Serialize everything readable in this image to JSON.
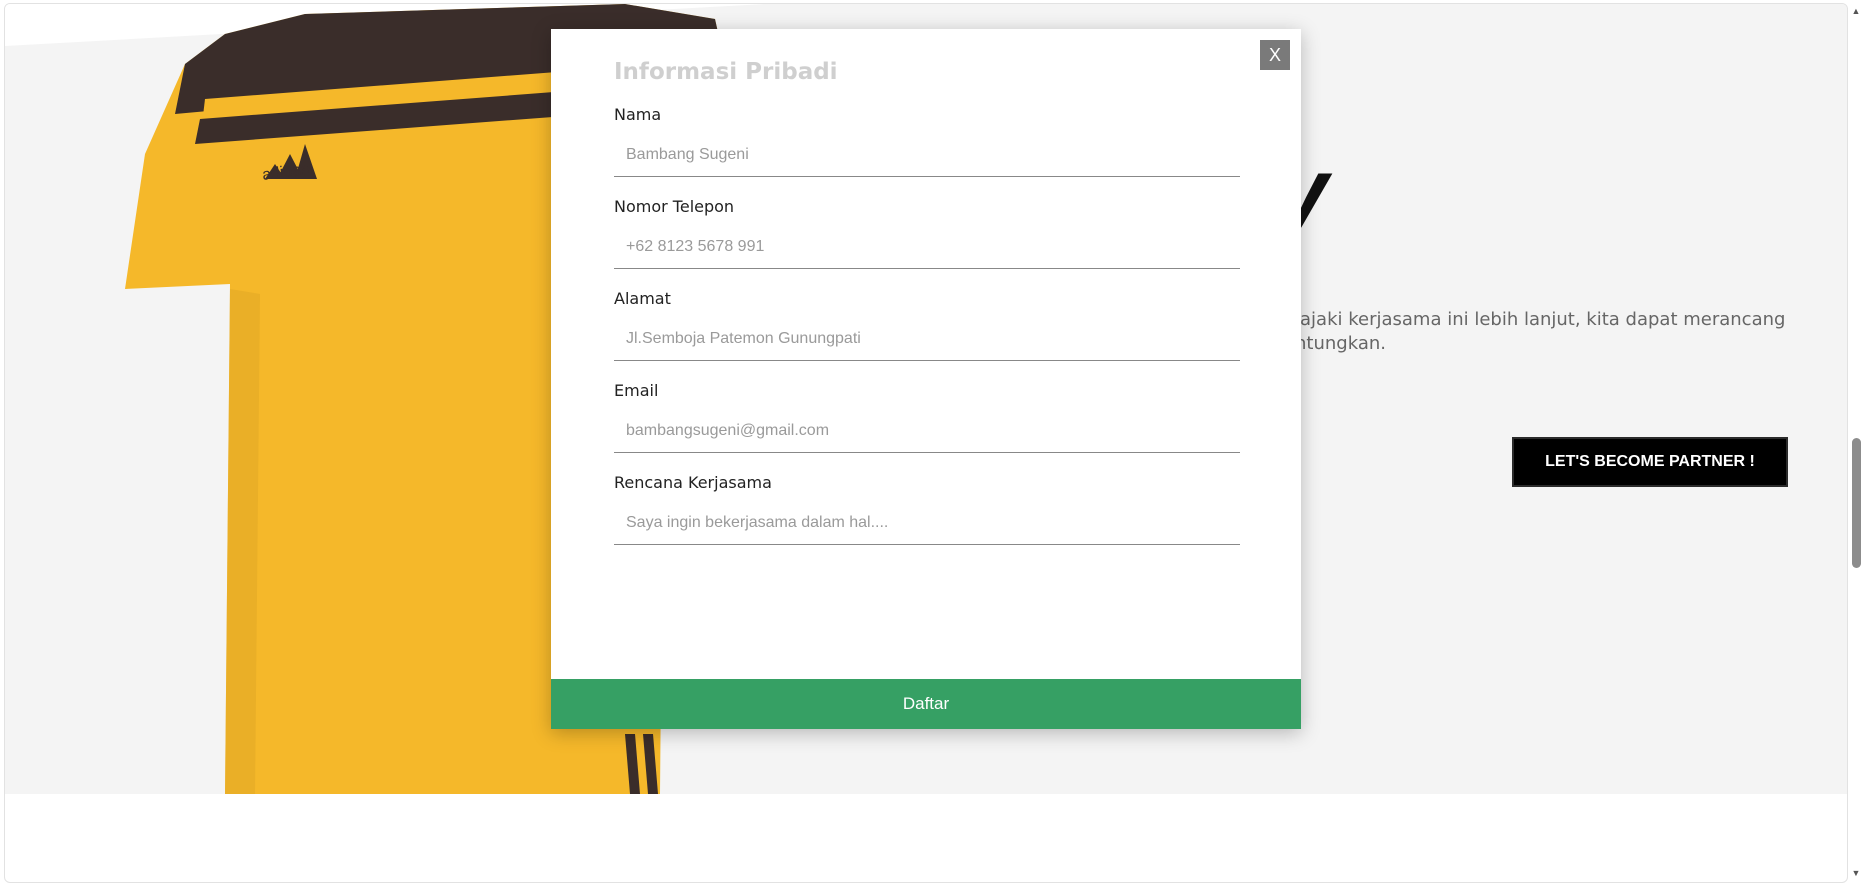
{
  "hero": {
    "heading_fragment": "y",
    "description_line1": "jajaki kerjasama ini lebih lanjut, kita dapat merancang",
    "description_line2": "ntungkan.",
    "partner_button": "LET'S BECOME PARTNER !",
    "shirt_brand": "adidas",
    "colors": {
      "shirt": "#f5b82a",
      "stripe": "#3a2d2a",
      "background": "#f4f4f4"
    }
  },
  "modal": {
    "close_label": "X",
    "title": "Informasi Pribadi",
    "fields": [
      {
        "label": "Nama",
        "placeholder": "Bambang Sugeni"
      },
      {
        "label": "Nomor Telepon",
        "placeholder": "+62 8123 5678 991"
      },
      {
        "label": "Alamat",
        "placeholder": "Jl.Semboja Patemon Gunungpati"
      },
      {
        "label": "Email",
        "placeholder": "bambangsugeni@gmail.com"
      },
      {
        "label": "Rencana Kerjasama",
        "placeholder": "Saya ingin bekerjasama dalam hal...."
      }
    ],
    "submit_label": "Daftar",
    "colors": {
      "submit": "#36a064",
      "close": "#7a7a7a"
    }
  },
  "scrollbar": {
    "up_icon": "chevron-up-icon",
    "down_icon": "chevron-down-icon"
  }
}
